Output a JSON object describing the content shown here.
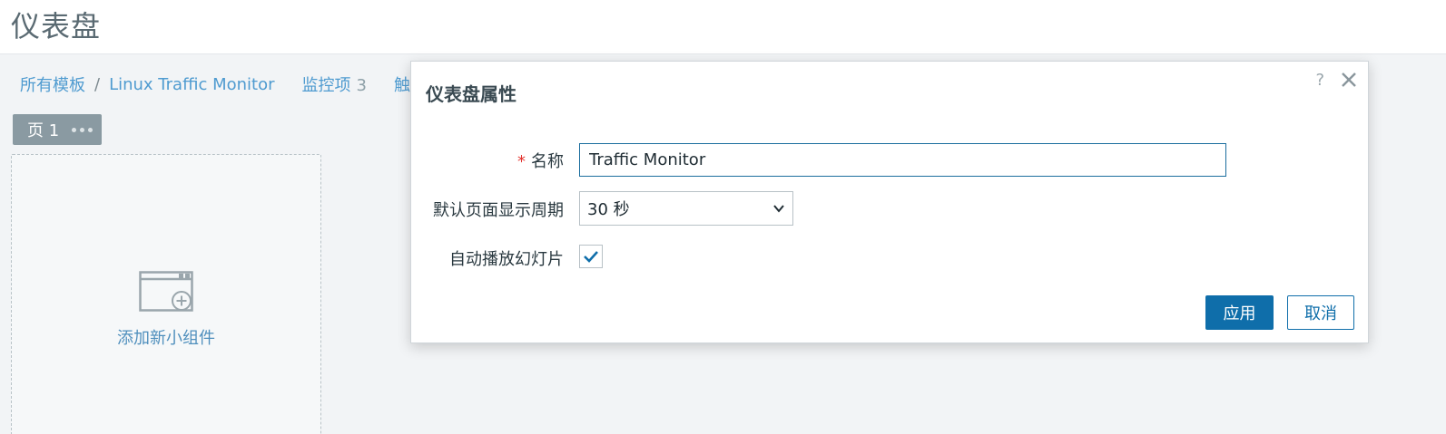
{
  "header": {
    "title": "仪表盘"
  },
  "breadcrumb": {
    "all_templates": "所有模板",
    "separator": "/",
    "template": "Linux Traffic Monitor",
    "items_label": "监控项",
    "items_count": "3",
    "triggers_label": "触发器"
  },
  "page_tab": {
    "label": "页 1"
  },
  "widget": {
    "add_label": "添加新小组件"
  },
  "dialog": {
    "title": "仪表盘属性",
    "help": "?",
    "name_required": "*",
    "name_label": "名称",
    "name_value": "Traffic Monitor",
    "period_label": "默认页面显示周期",
    "period_value": "30 秒",
    "slideshow_label": "自动播放幻灯片",
    "slideshow_checked": true,
    "apply_label": "应用",
    "cancel_label": "取消"
  },
  "colors": {
    "primary": "#0f6eaa",
    "link": "#4f9bd0",
    "required": "#e3342f"
  }
}
